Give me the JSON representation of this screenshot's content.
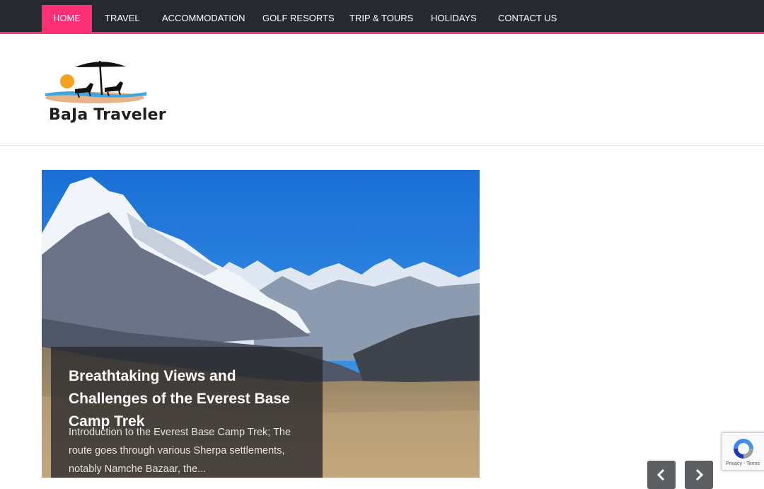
{
  "nav": {
    "items": [
      {
        "label": "HOME",
        "active": true
      },
      {
        "label": "TRAVEL",
        "active": false
      },
      {
        "label": "ACCOMMODATION",
        "active": false
      },
      {
        "label": "GOLF RESORTS",
        "active": false
      },
      {
        "label": "TRIP & TOURS",
        "active": false
      },
      {
        "label": "HOLIDAYS",
        "active": false
      },
      {
        "label": "CONTACT US",
        "active": false
      }
    ]
  },
  "brand": {
    "name": "BaJa Traveler",
    "accent_color": "#ff2f76",
    "nav_bg": "#262a30"
  },
  "slider": {
    "title": "Breathtaking Views and Challenges of the Everest Base Camp Trek",
    "excerpt": "Introduction to the Everest Base Camp Trek; The route goes through various Sherpa settlements, notably Namche Bazaar, the...",
    "prev_icon": "chevron-left-icon",
    "next_icon": "chevron-right-icon"
  },
  "recaptcha": {
    "links": "Privacy - Terms"
  }
}
